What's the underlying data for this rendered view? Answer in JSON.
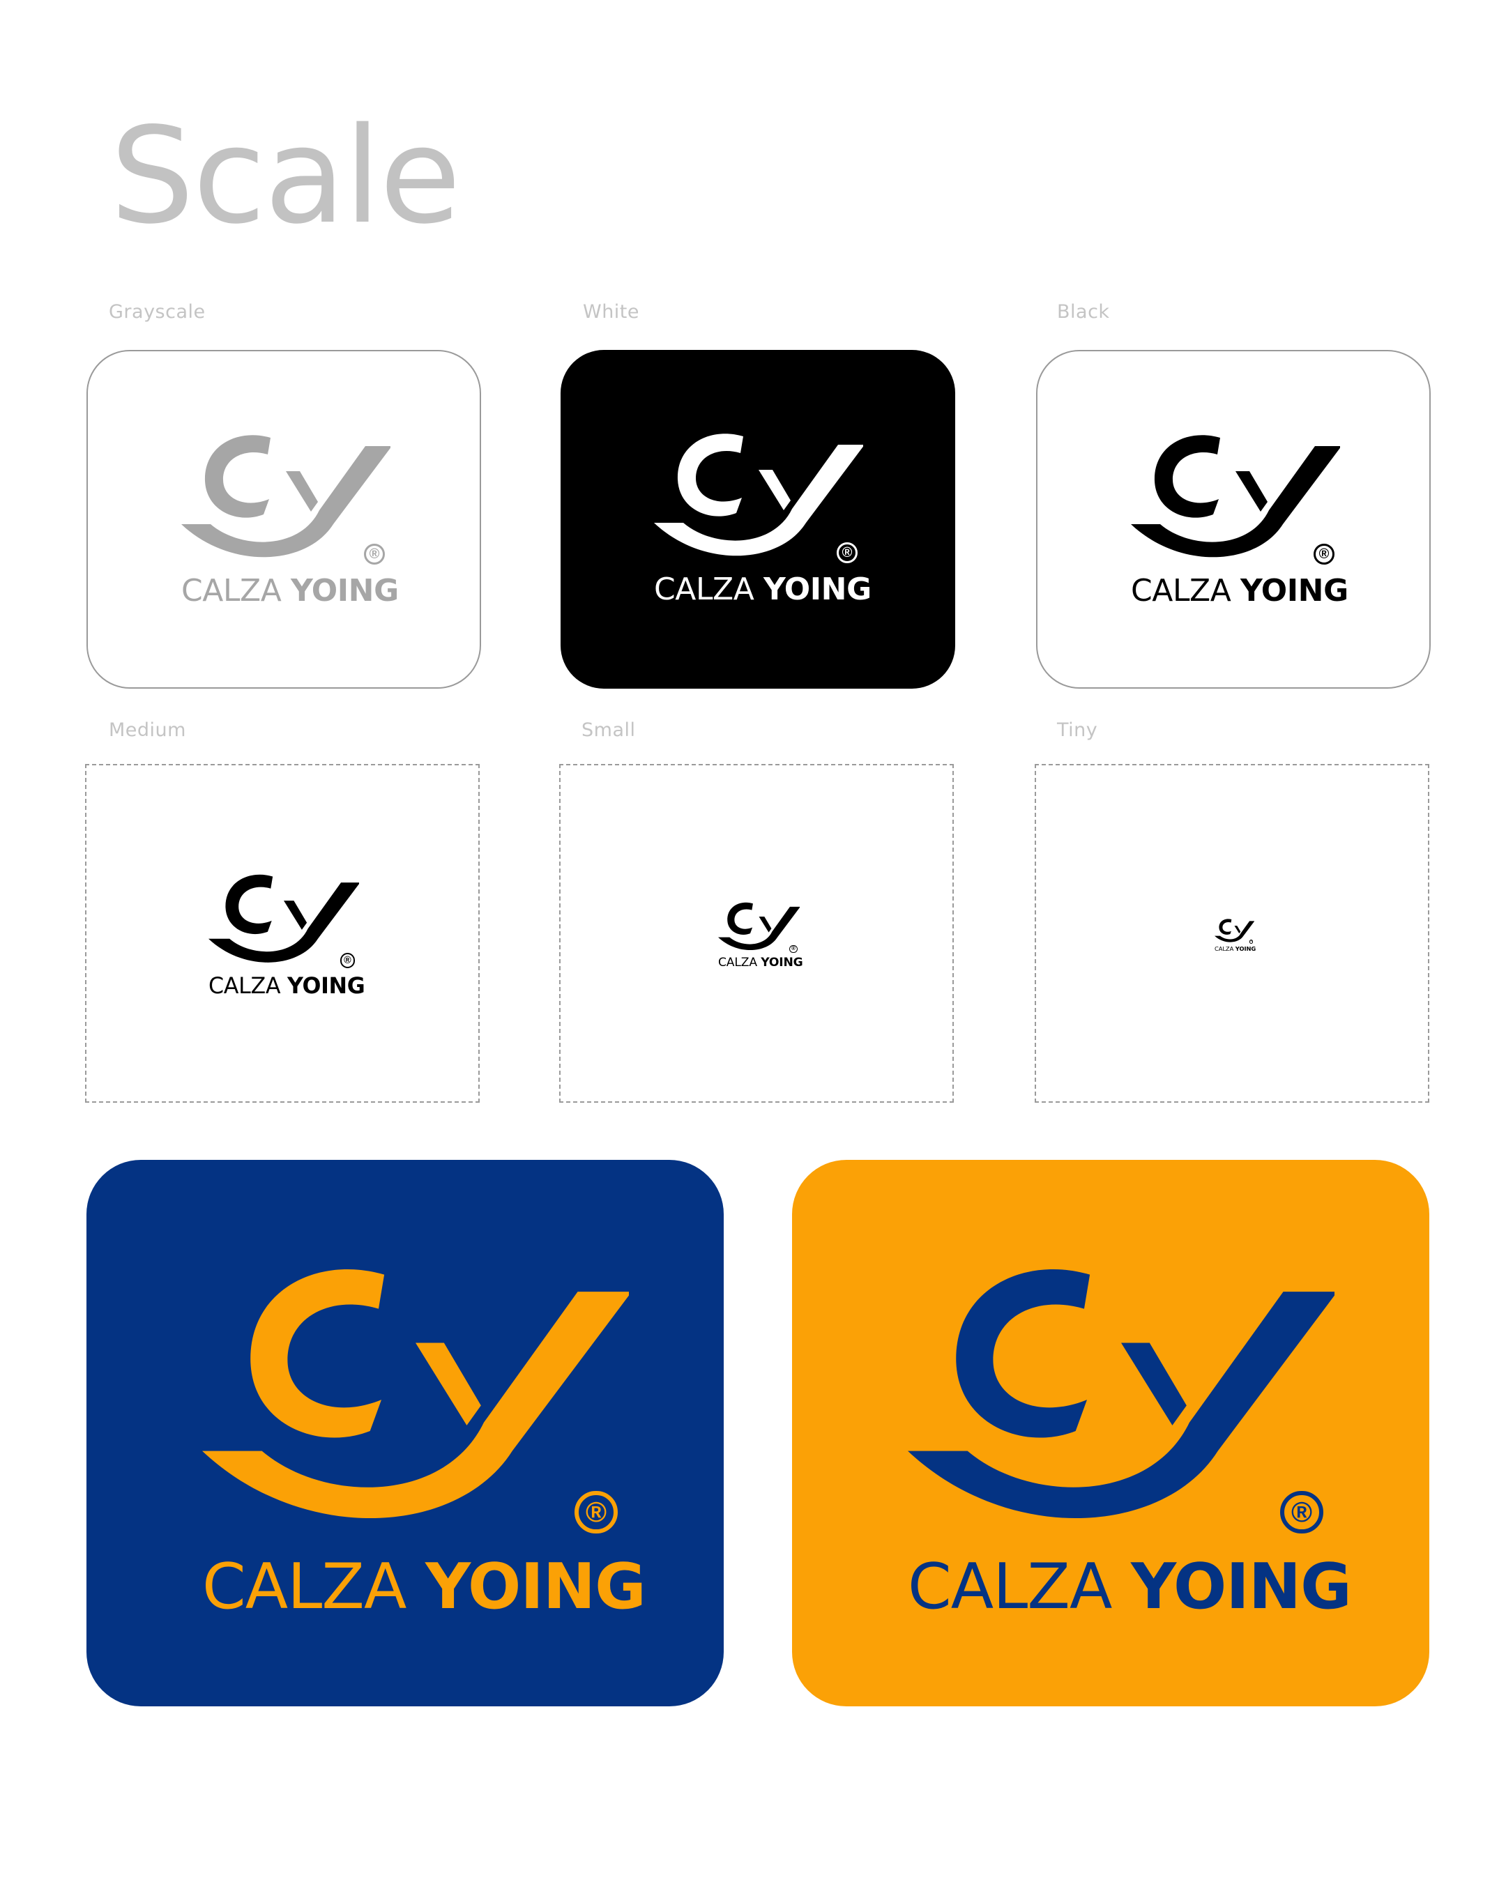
{
  "title": "Scale",
  "labels": {
    "grayscale": "Grayscale",
    "white": "White",
    "black": "Black",
    "medium": "Medium",
    "small": "Small",
    "tiny": "Tiny"
  },
  "logo": {
    "brand_light": "CALZA",
    "brand_bold": "YOING",
    "registered": "®",
    "icon": "cy-monogram-icon"
  },
  "colors": {
    "gray": "#a6a6a6",
    "black": "#000000",
    "white": "#ffffff",
    "navy": "#043383",
    "orange": "#fba106",
    "label": "#c4c4c4",
    "title": "#c2c2c2"
  }
}
